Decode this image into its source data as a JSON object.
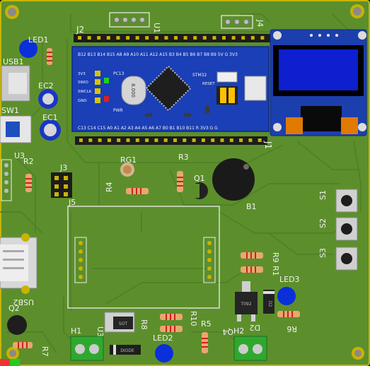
{
  "pcb": {
    "refdes": {
      "led1": "LED1",
      "usb1": "USB1",
      "ec2": "EC2",
      "ec1": "EC1",
      "sw1": "SW1",
      "u3": "U3",
      "r2": "R2",
      "j3": "J3",
      "j5": "J5",
      "j2": "J2",
      "j1": "J1",
      "u1": "U1",
      "j4": "J4",
      "rg1": "RG1",
      "r3": "R3",
      "r4": "R4",
      "q1": "Q1",
      "b1": "B1",
      "s1": "S1",
      "s2": "S2",
      "s3": "S3",
      "r9": "R9",
      "r1": "R1",
      "led3": "LED3",
      "r6": "R6",
      "d2": "D2",
      "q4": "Q4",
      "h2": "H2",
      "r5": "R5",
      "r10": "R10",
      "r8": "R8",
      "led2": "LED2",
      "u3b": "U3",
      "h1": "H1",
      "usb2": "USB2",
      "q2": "Q2",
      "r7": "R7"
    },
    "module": {
      "chip": "STM32",
      "crystal": "8.000",
      "pc13": "PC13",
      "pwr": "PWR",
      "reset": "RESET",
      "swd": [
        "3V3",
        "SWIO",
        "SWCLK",
        "GND"
      ],
      "top_pins": "B12 B13 B14 B15 A8 A9 A10 A11 A12 A15 B3 B4 B5 B6 B7 B8 B9 5V G 3V3",
      "bottom_pins": "C13 C14 C15 A0 A1 A2 A3 A4 A5 A6 A7 B0 B1 B10 B11 R 3V3 G G"
    },
    "parts": {
      "d1": "DIODE",
      "q4_pkg": "T092",
      "d2_pkg": "D2",
      "rg_pkg": "SOT"
    }
  }
}
